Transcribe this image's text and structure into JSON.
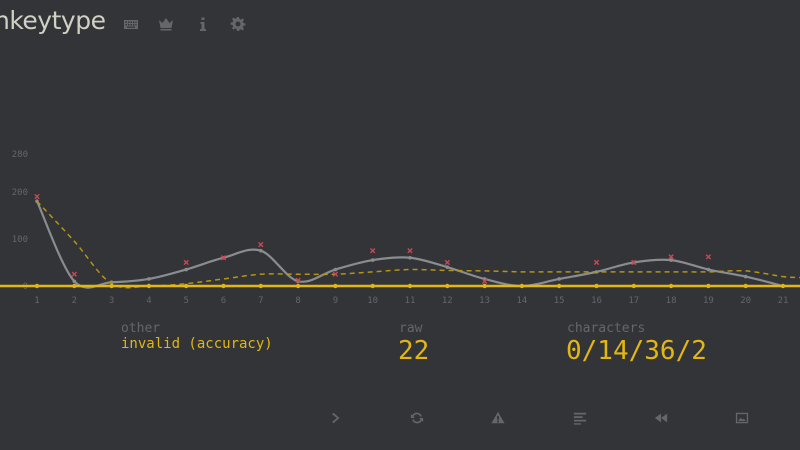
{
  "header": {
    "logo_text": "nkeytype",
    "icons": [
      "keyboard-icon",
      "crown-icon",
      "info-icon",
      "gear-icon"
    ]
  },
  "stats": {
    "other_label": "other",
    "other_value": "invalid (accuracy)",
    "raw_label": "raw",
    "raw_value": "22",
    "characters_label": "characters",
    "characters_value": "0/14/36/2"
  },
  "buttons": [
    "next-test-icon",
    "restart-icon",
    "warning-icon",
    "words-history-icon",
    "replay-icon",
    "screenshot-icon"
  ],
  "colors": {
    "background": "#323437",
    "accent": "#e2b714",
    "sub": "#646669",
    "wpm_line": "#8a8d90",
    "error": "#ca4754",
    "text": "#d1d0c5"
  },
  "chart_data": {
    "type": "line",
    "x": [
      1,
      2,
      3,
      4,
      5,
      6,
      7,
      8,
      9,
      10,
      11,
      12,
      13,
      14,
      15,
      16,
      17,
      18,
      19,
      20,
      21
    ],
    "x_ticks": [
      "1",
      "2",
      "3",
      "4",
      "5",
      "6",
      "7",
      "8",
      "9",
      "10",
      "11",
      "12",
      "13",
      "14",
      "15",
      "16",
      "17",
      "18",
      "19",
      "20",
      "21"
    ],
    "y_ticks": [
      "0",
      "100",
      "200",
      "280"
    ],
    "ylim": [
      0,
      280
    ],
    "series": [
      {
        "style": "solid-gray",
        "values": [
          180,
          10,
          8,
          15,
          35,
          60,
          75,
          10,
          35,
          55,
          60,
          40,
          15,
          0,
          15,
          30,
          50,
          55,
          35,
          20,
          0
        ]
      },
      {
        "style": "dashed-yellow",
        "values": [
          180,
          95,
          5,
          0,
          5,
          15,
          25,
          25,
          25,
          30,
          35,
          33,
          32,
          30,
          30,
          30,
          30,
          30,
          30,
          32,
          20
        ]
      },
      {
        "style": "solid-yellow-base",
        "values": [
          0,
          0,
          0,
          0,
          0,
          0,
          0,
          0,
          0,
          0,
          0,
          0,
          0,
          0,
          0,
          0,
          0,
          0,
          0,
          0,
          0
        ]
      }
    ],
    "error_marks": [
      {
        "x": 1,
        "y": 190
      },
      {
        "x": 2,
        "y": 25
      },
      {
        "x": 5,
        "y": 50
      },
      {
        "x": 6,
        "y": 60
      },
      {
        "x": 7,
        "y": 88
      },
      {
        "x": 8,
        "y": 12
      },
      {
        "x": 9,
        "y": 25
      },
      {
        "x": 10,
        "y": 75
      },
      {
        "x": 11,
        "y": 75
      },
      {
        "x": 12,
        "y": 50
      },
      {
        "x": 13,
        "y": 10
      },
      {
        "x": 16,
        "y": 50
      },
      {
        "x": 17,
        "y": 50
      },
      {
        "x": 18,
        "y": 62
      },
      {
        "x": 19,
        "y": 62
      }
    ],
    "grid": false
  }
}
